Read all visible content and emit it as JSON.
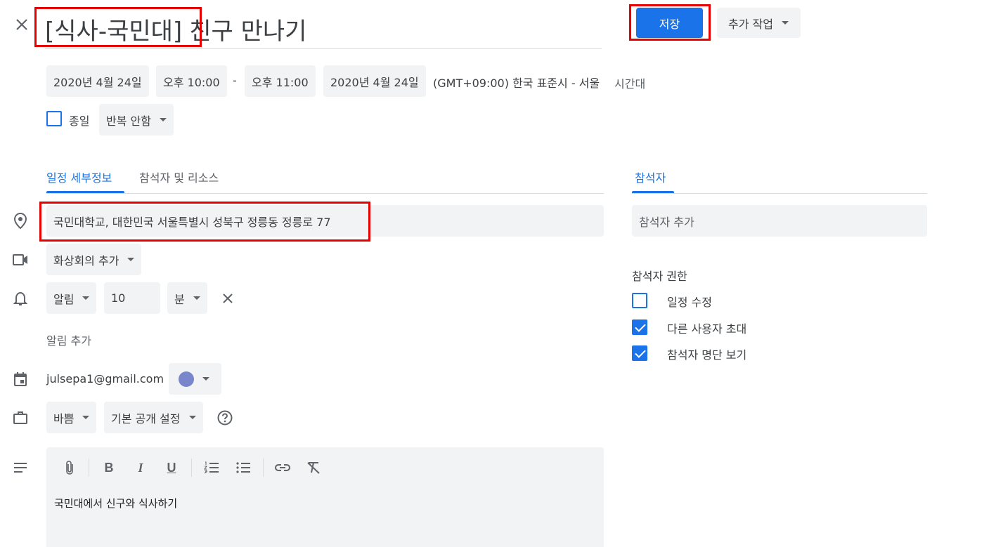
{
  "title": {
    "highlighted": "[식사-국민대]",
    "rest": "친구 만나기"
  },
  "header": {
    "save_label": "저장",
    "more_actions_label": "추가 작업"
  },
  "datetime": {
    "start_date": "2020년 4월 24일",
    "start_time": "오후 10:00",
    "separator": "-",
    "end_time": "오후 11:00",
    "end_date": "2020년 4월 24일",
    "timezone": "(GMT+09:00) 한국 표준시 - 서울",
    "timezone_link": "시간대"
  },
  "allday": {
    "label": "종일",
    "checked": false
  },
  "repeat": {
    "selected": "반복 안함"
  },
  "tabs": {
    "details": "일정 세부정보",
    "guests_rooms": "참석자 및 리소스",
    "active": "details"
  },
  "location": {
    "value": "국민대학교, 대한민국 서울특별시 성북구 정릉동 정릉로 77"
  },
  "conference": {
    "label": "화상회의 추가"
  },
  "notification": {
    "type": "알림",
    "amount": "10",
    "unit": "분",
    "add_label": "알림 추가"
  },
  "calendar": {
    "account": "julsepa1@gmail.com",
    "color": "#7986cb"
  },
  "availability": {
    "busy": "바쁨",
    "visibility": "기본 공개 설정"
  },
  "description": {
    "text": "국민대에서 신구와 식사하기"
  },
  "guests": {
    "tab_label": "참석자",
    "add_placeholder": "참석자 추가",
    "permissions_title": "참석자 권한",
    "permissions": [
      {
        "label": "일정 수정",
        "checked": false
      },
      {
        "label": "다른 사용자 초대",
        "checked": true
      },
      {
        "label": "참석자 명단 보기",
        "checked": true
      }
    ]
  },
  "colors": {
    "accent": "#1a73e8",
    "highlight_box": "#e60000",
    "chip_bg": "#f1f3f4"
  }
}
